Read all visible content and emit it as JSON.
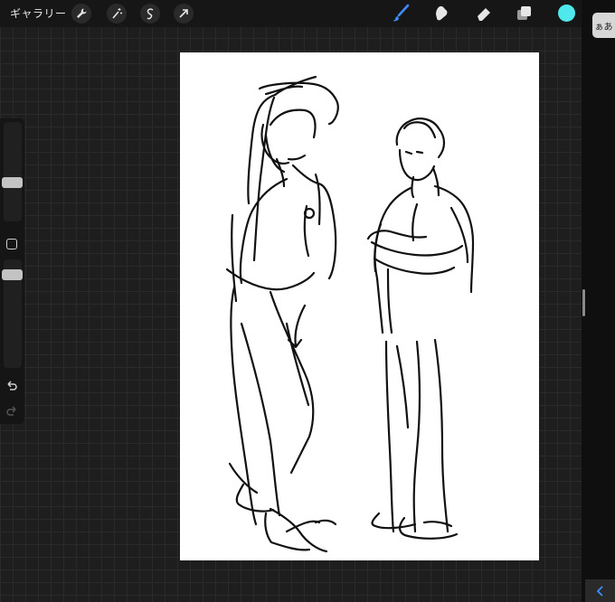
{
  "topbar": {
    "gallery_label": "ギャラリー",
    "left_tools": [
      "wrench-icon",
      "magic-wand-icon",
      "selection-icon",
      "transform-arrow-icon"
    ],
    "right_tools": [
      "brush-icon",
      "smudge-icon",
      "eraser-icon",
      "layers-icon"
    ],
    "active_tool": "brush-icon",
    "accent_color": "#3f8cff",
    "current_color": "#4fe8ec"
  },
  "sidebar": {
    "brush_size_level": 0.55,
    "opacity_level": 0.15,
    "icons": [
      "modify-square-icon",
      "undo-icon",
      "redo-icon"
    ]
  },
  "keyboard": {
    "kana_label": "ぁあ"
  },
  "canvas": {
    "background": "#ffffff",
    "content": "pencil-sketch-two-figures"
  }
}
